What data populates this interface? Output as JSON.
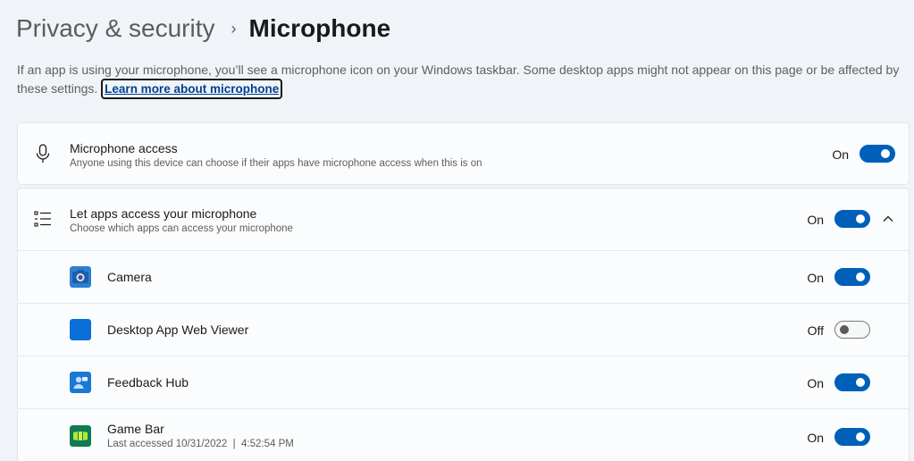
{
  "breadcrumb": {
    "parent": "Privacy & security",
    "separator": "›",
    "current": "Microphone"
  },
  "description": {
    "text": "If an app is using your microphone, you’ll see a microphone icon on your Windows taskbar. Some desktop apps might not appear on this page or be affected by these settings.",
    "link": "Learn more about microphone"
  },
  "microphone_access": {
    "title": "Microphone access",
    "subtitle": "Anyone using this device can choose if their apps have microphone access when this is on",
    "state": "On",
    "enabled": true,
    "icon": "microphone-icon"
  },
  "apps_access": {
    "title": "Let apps access your microphone",
    "subtitle": "Choose which apps can access your microphone",
    "state": "On",
    "enabled": true,
    "icon": "list-icon",
    "expanded": true
  },
  "apps": [
    {
      "name": "Camera",
      "state": "On",
      "enabled": true,
      "icon": "camera-app-icon",
      "subtitle": ""
    },
    {
      "name": "Desktop App Web Viewer",
      "state": "Off",
      "enabled": false,
      "icon": "web-viewer-app-icon",
      "subtitle": ""
    },
    {
      "name": "Feedback Hub",
      "state": "On",
      "enabled": true,
      "icon": "feedback-hub-app-icon",
      "subtitle": ""
    },
    {
      "name": "Game Bar",
      "state": "On",
      "enabled": true,
      "icon": "game-bar-app-icon",
      "subtitle": "Last accessed 10/31/2022  |  4:52:54 PM"
    }
  ],
  "colors": {
    "accent": "#005fb8",
    "background": "#f0f4f9",
    "card": "#fbfcfd"
  }
}
